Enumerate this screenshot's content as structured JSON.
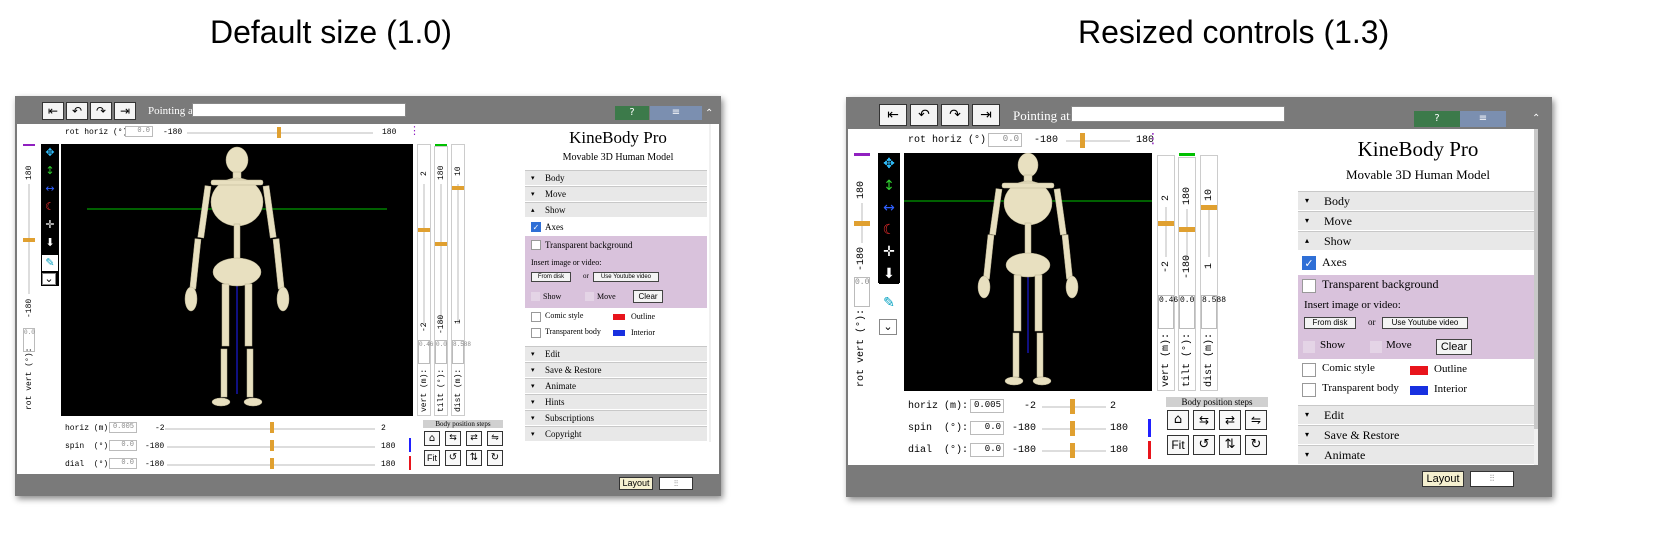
{
  "captions": {
    "left": "Default size (1.0)",
    "right": "Resized controls (1.3)"
  },
  "app": {
    "title": "KineBody Pro",
    "subtitle": "Movable 3D Human Model",
    "pointing_label": "Pointing at:",
    "help_icon": "?",
    "menu_icon": "≡",
    "nav_icons": [
      "undo-all-icon",
      "undo-icon",
      "redo-icon",
      "redo-all-icon"
    ]
  },
  "controls": {
    "rot_horiz_label": "rot horiz (°):",
    "rot_horiz_value": "0.0",
    "rot_horiz_min": "-180",
    "rot_horiz_max": "180",
    "rot_vert_label": "rot vert (°):",
    "rot_vert_value": "0.0",
    "rot_vert_min": "-180",
    "rot_vert_max": "180",
    "horiz_label": "horiz (m):",
    "horiz_value": "0.005",
    "horiz_min": "-2",
    "horiz_max": "2",
    "spin_label": "spin  (°):",
    "spin_value": "0.0",
    "spin_min": "-180",
    "spin_max": "180",
    "dial_label": "dial  (°):",
    "dial_value": "0.0",
    "dial_min": "-180",
    "dial_max": "180",
    "vert_label": "vert  (m):",
    "vert_value": "0.465",
    "vert_min": "-2",
    "vert_max": "2",
    "tilt_label": "tilt  (°):",
    "tilt_value": "0.0",
    "tilt_min": "-180",
    "tilt_max": "180",
    "dist_label": "dist  (m):",
    "dist_value": "8.588",
    "dist_min": "1",
    "dist_max": "10",
    "steps_label": "Body position steps",
    "fit_label": "Fit"
  },
  "sections": {
    "body": "Body",
    "move": "Move",
    "show": "Show",
    "edit": "Edit",
    "save_restore": "Save & Restore",
    "animate": "Animate",
    "hints": "Hints",
    "subscriptions": "Subscriptions",
    "copyright": "Copyright"
  },
  "show": {
    "axes": "Axes",
    "transparent_background": "Transparent background",
    "insert_label": "Insert image or video:",
    "from_disk": "From disk",
    "or": "or",
    "youtube": "Use Youtube video",
    "show": "Show",
    "move": "Move",
    "clear": "Clear",
    "comic_style": "Comic style",
    "outline": "Outline",
    "transparent_body": "Transparent body",
    "interior": "Interior"
  },
  "bottom": {
    "layout": "Layout",
    "settings_icon": "⫶⫶"
  },
  "colors": {
    "panel_gray": "#7a7a7a",
    "viewport": "#000000",
    "slider_thumb": "#e0a030",
    "purple_zone": "#d9c2dc",
    "outline_swatch": "#e8141c",
    "interior_swatch": "#1830e0",
    "help_green": "#3c7a4a",
    "axis_green": "#00c000",
    "axis_blue": "#2020ff"
  }
}
